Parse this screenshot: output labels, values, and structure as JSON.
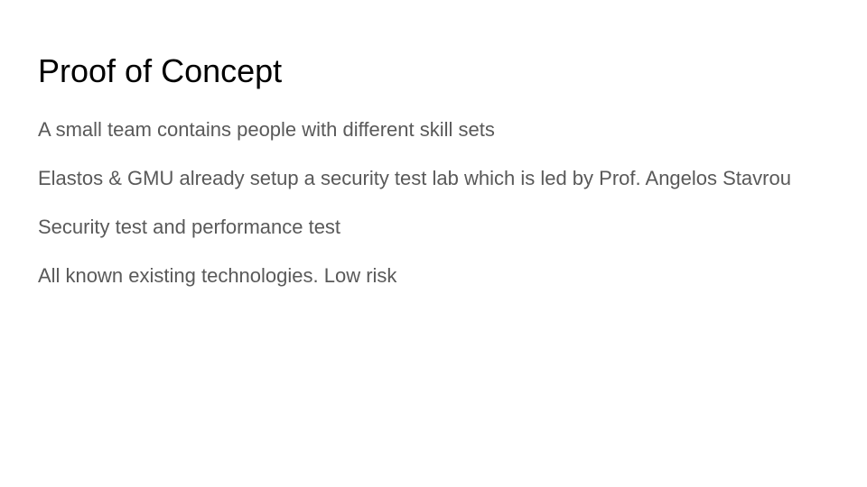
{
  "slide": {
    "title": "Proof of Concept",
    "points": [
      "A small team contains people with different skill sets",
      "Elastos & GMU already setup a security test lab which is led by Prof. Angelos Stavrou",
      "Security test and performance test",
      "All known existing technologies. Low risk"
    ]
  },
  "colors": {
    "title": "#000000",
    "body_text": "#595959",
    "background": "#ffffff"
  }
}
